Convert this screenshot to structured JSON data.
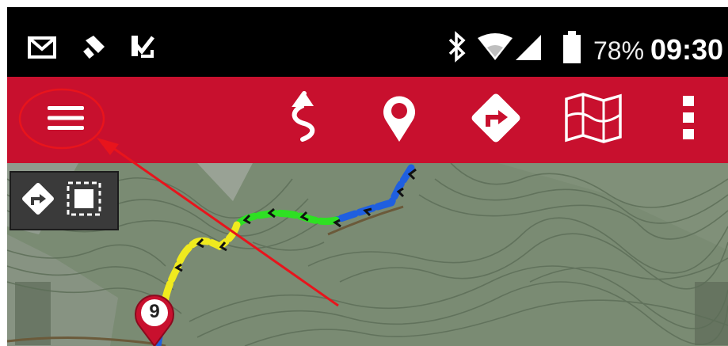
{
  "status_bar": {
    "battery_percent": "78%",
    "time": "09:30",
    "icons": [
      "gmail-icon",
      "tool-icon",
      "task-check-icon",
      "bluetooth-icon",
      "wifi-icon",
      "cell-signal-icon",
      "battery-icon"
    ]
  },
  "toolbar": {
    "background": "#c8102e",
    "buttons": [
      "menu-icon",
      "track-route-icon",
      "location-pin-icon",
      "navigate-turn-icon",
      "map-icon",
      "more-vert-icon"
    ]
  },
  "map": {
    "waypoint_label": "9",
    "track_colors": [
      "#1f5fe0",
      "#2ee023",
      "#f0ea1e"
    ]
  },
  "annotation": {
    "color": "#e8141c"
  }
}
